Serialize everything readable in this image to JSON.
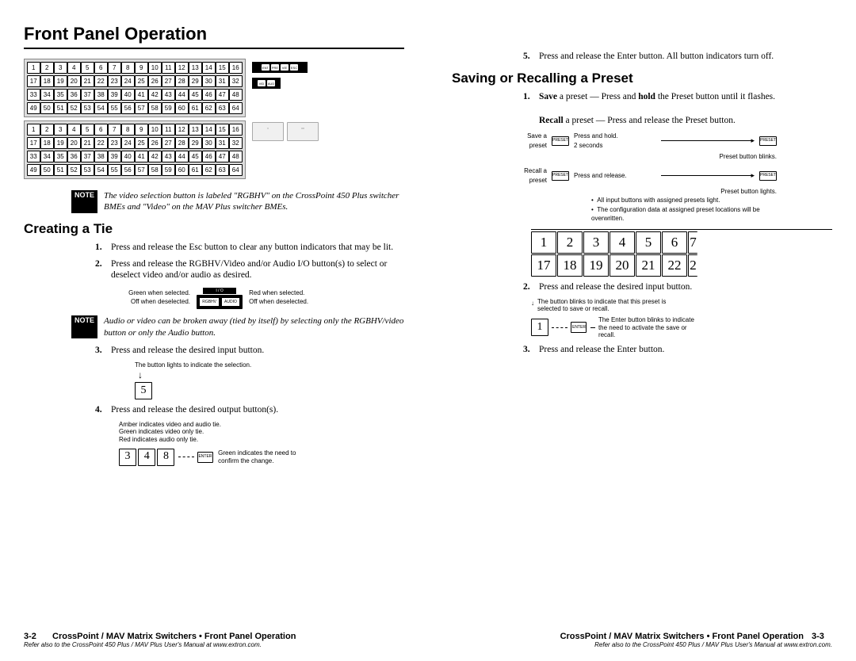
{
  "titles": {
    "main": "Front Panel Operation",
    "creating": "Creating a Tie",
    "saving": "Saving or Recalling a Preset"
  },
  "note_tag": "NOTE",
  "note1": "The video selection button is labeled \"RGBHV\" on the CrossPoint 450 Plus switcher BMEs and \"Video\" on the MAV Plus switcher BMEs.",
  "note2": "Audio or video can be broken away (tied by itself) by selecting only the RGBHV/video button or only the Audio button.",
  "left_steps": {
    "s1": "Press and release the Esc button to clear any button indicators that may be lit.",
    "s2": "Press and release the RGBHV/Video and/or Audio I/O button(s) to select or deselect video and/or audio as desired.",
    "s3": "Press and release the desired input button.",
    "s4": "Press and release the desired output button(s).",
    "s5": "Press and release the Enter button. All button indicators turn off."
  },
  "fig_io": {
    "left1": "Green when selected.",
    "left2": "Off when deselected.",
    "btn1": "RGBHV",
    "btn2": "AUDIO",
    "io_label": "I / O",
    "right1": "Red when selected.",
    "right2": "Off when deselected."
  },
  "fig_5": {
    "caption": "The button lights to indicate the selection.",
    "btn": "5"
  },
  "fig_out": {
    "line1": "Amber indicates video and audio tie.",
    "line2": "Green indicates video only tie.",
    "line3": "Red indicates audio only tie.",
    "b1": "3",
    "b2": "4",
    "b3": "8",
    "enter": "ENTER",
    "enter_text": "Green indicates the need to confirm the change."
  },
  "right_steps": {
    "s1a": "Save",
    "s1b": " a preset — Press and ",
    "s1c": "hold",
    "s1d": " the Preset button until it flashes.",
    "s1recall": "Recall",
    "s1recall2": " a preset — Press and release the Preset button.",
    "s2": "Press and release the desired input button.",
    "s3": "Press and release the Enter button."
  },
  "preset": {
    "save_lbl": "Save a preset",
    "recall_lbl": "Recall a preset",
    "hold": "Press and hold.",
    "sec": "2 seconds",
    "blinks": "Preset button blinks.",
    "release": "Press and release.",
    "lights": "Preset button lights.",
    "btn": "PRESET",
    "bullet1": "All input buttons with assigned presets light.",
    "bullet2": "The configuration data at assigned preset locations will be overwritten."
  },
  "biggrid": {
    "r1": [
      "1",
      "2",
      "3",
      "4",
      "5",
      "6"
    ],
    "r2": [
      "17",
      "18",
      "19",
      "20",
      "21",
      "22"
    ]
  },
  "fig_input": {
    "caption": "The button blinks to indicate that this preset is selected to save or recall.",
    "btn": "1",
    "enter": "ENTER",
    "enter_text": "The Enter button blinks to indicate the need to activate the save or recall."
  },
  "footer": {
    "left_pg": "3-2",
    "right_pg": "3-3",
    "title": "CrossPoint / MAV Matrix Switchers • Front Panel Operation",
    "sub": "Refer also to the CrossPoint 450 Plus / MAV Plus User's Manual at www.extron.com."
  },
  "ctrl_labels": [
    "ENTER",
    "PRESET",
    "VIEW",
    "ESC"
  ],
  "io_labels": [
    "VIDEO",
    "AUDIO"
  ],
  "aux": {
    "config": "CONFIG",
    "amp": "AMPLIFIER"
  }
}
